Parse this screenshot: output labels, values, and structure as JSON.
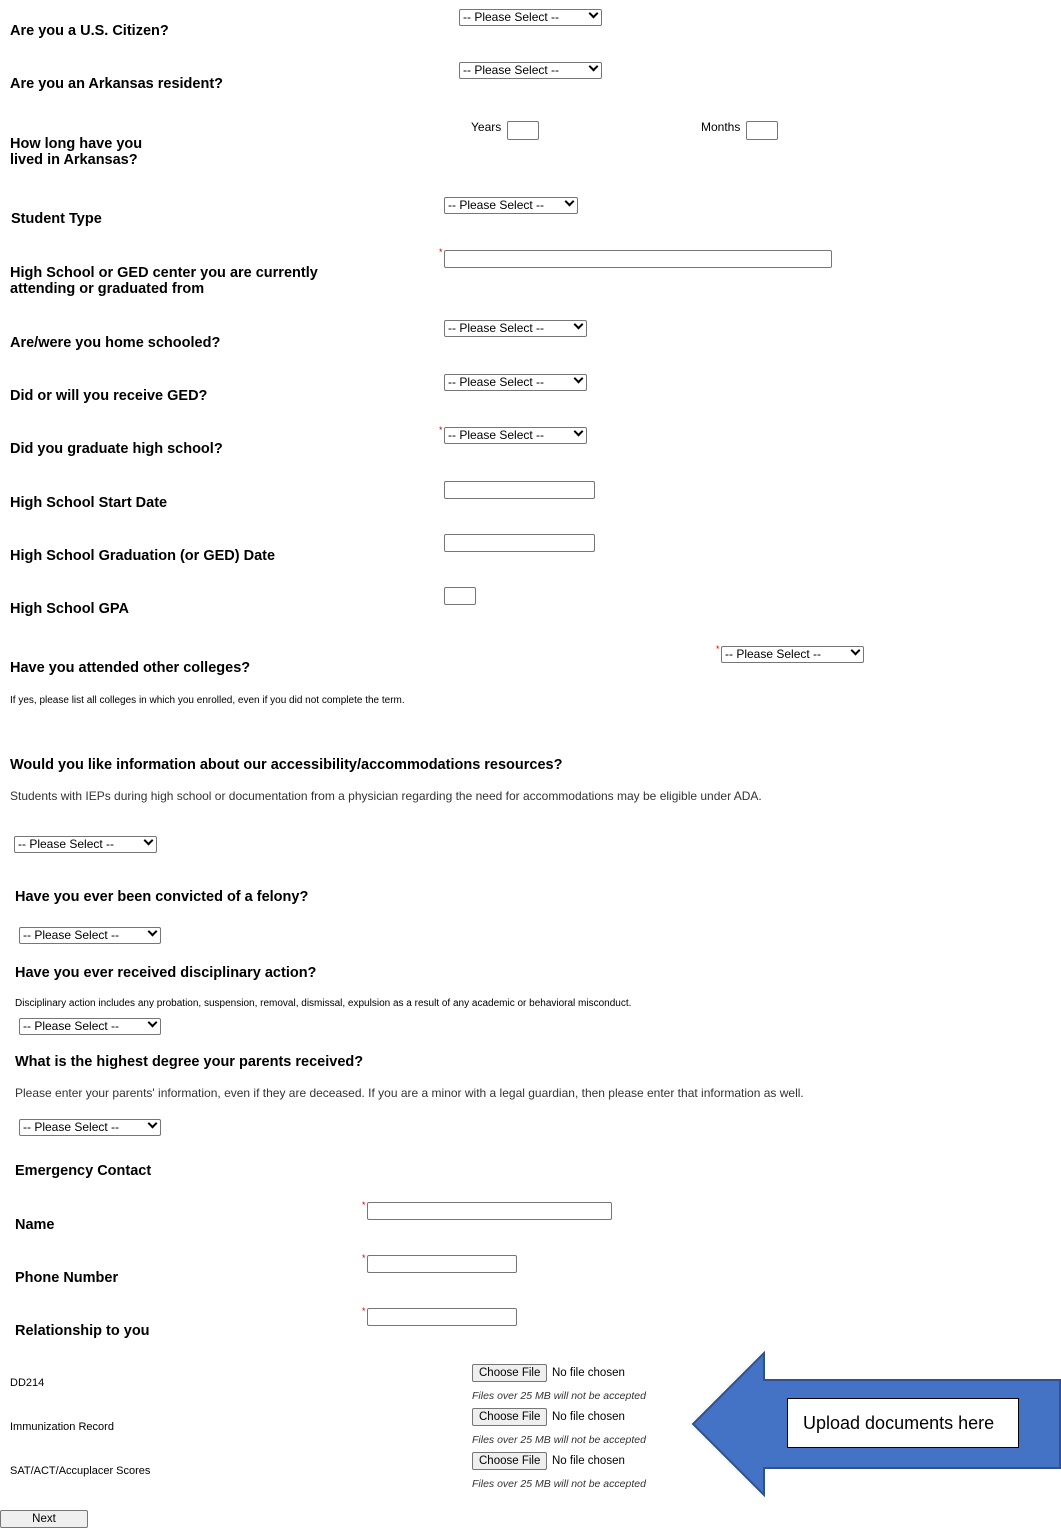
{
  "placeholder_select": "-- Please Select --",
  "questions": {
    "citizen": "Are you a U.S. Citizen?",
    "resident": "Are you an Arkansas resident?",
    "how_long": "How long have you lived in Arkansas?",
    "years_label": "Years",
    "months_label": "Months",
    "student_type": "Student Type",
    "high_school": "High School or GED center you are currently attending or graduated from",
    "home_schooled": "Are/were you home schooled?",
    "ged": "Did or will you receive GED?",
    "graduate_hs": "Did you graduate high school?",
    "hs_start": "High School Start Date",
    "hs_grad": "High School Graduation (or GED) Date",
    "hs_gpa": "High School GPA",
    "other_colleges": "Have you attended other colleges?",
    "other_colleges_note": "If yes, please list all colleges in which you enrolled, even if you did not complete the term.",
    "accessibility": "Would you like information about our accessibility/accommodations resources?",
    "accessibility_note": "Students with IEPs during high school or documentation from a physician regarding the need for accommodations may be eligible under ADA.",
    "felony": "Have you ever been convicted of a felony?",
    "disciplinary": "Have you ever received disciplinary action?",
    "disciplinary_note": "Disciplinary action includes any probation, suspension, removal, dismissal, expulsion as a result of any academic or behavioral misconduct.",
    "parents_degree": "What is the highest degree your parents received?",
    "parents_note": "Please enter your parents' information, even if they are deceased. If you are a minor with a legal guardian, then please enter that information as well."
  },
  "emergency": {
    "heading": "Emergency Contact",
    "name": "Name",
    "phone": "Phone Number",
    "relationship": "Relationship to you"
  },
  "uploads": [
    {
      "label": "DD214",
      "button": "Choose File",
      "status": "No file chosen",
      "note": "Files over 25 MB will not be accepted"
    },
    {
      "label": "Immunization Record",
      "button": "Choose File",
      "status": "No file chosen",
      "note": "Files over 25 MB will not be accepted"
    },
    {
      "label": "SAT/ACT/Accuplacer Scores",
      "button": "Choose File",
      "status": "No file chosen",
      "note": "Files over 25 MB will not be accepted"
    }
  ],
  "callout": {
    "text": "Upload documents here",
    "arrow_color": "#4472c4",
    "border_color": "#2f528f"
  },
  "required_marker": "*",
  "next_button": "Next"
}
